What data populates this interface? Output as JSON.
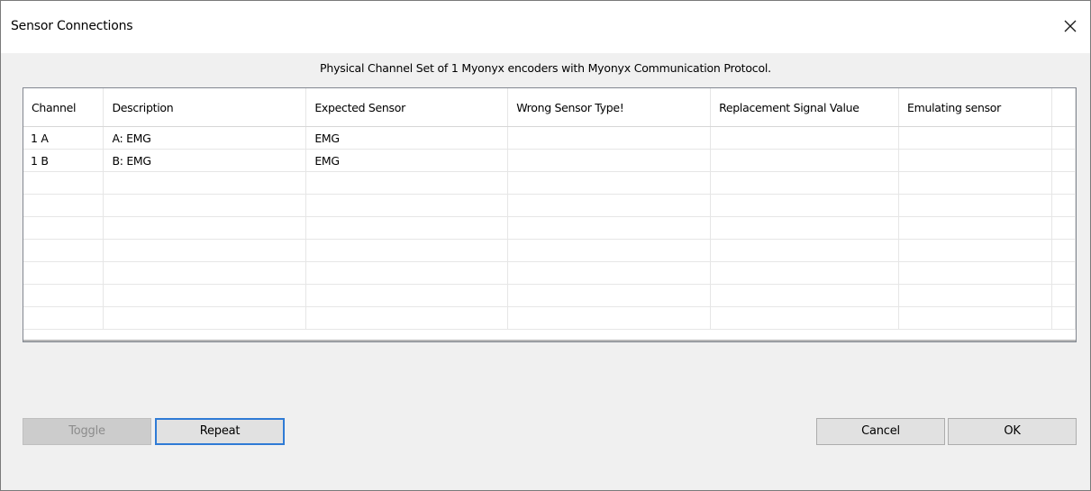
{
  "window": {
    "title": "Sensor Connections"
  },
  "subtitle": "Physical Channel Set of 1 Myonyx encoders with Myonyx Communication Protocol.",
  "table": {
    "columns": [
      "Channel",
      "Description",
      "Expected Sensor",
      "Wrong Sensor Type!",
      "Replacement Signal Value",
      "Emulating sensor"
    ],
    "rows": [
      [
        "1 A",
        "A: EMG",
        "EMG",
        "",
        "",
        ""
      ],
      [
        "1 B",
        "B: EMG",
        "EMG",
        "",
        "",
        ""
      ],
      [
        "",
        "",
        "",
        "",
        "",
        ""
      ],
      [
        "",
        "",
        "",
        "",
        "",
        ""
      ],
      [
        "",
        "",
        "",
        "",
        "",
        ""
      ],
      [
        "",
        "",
        "",
        "",
        "",
        ""
      ],
      [
        "",
        "",
        "",
        "",
        "",
        ""
      ],
      [
        "",
        "",
        "",
        "",
        "",
        ""
      ],
      [
        "",
        "",
        "",
        "",
        "",
        ""
      ]
    ]
  },
  "buttons": {
    "toggle": "Toggle",
    "repeat": "Repeat",
    "cancel": "Cancel",
    "ok": "OK"
  },
  "icons": {
    "close": "close-icon"
  }
}
